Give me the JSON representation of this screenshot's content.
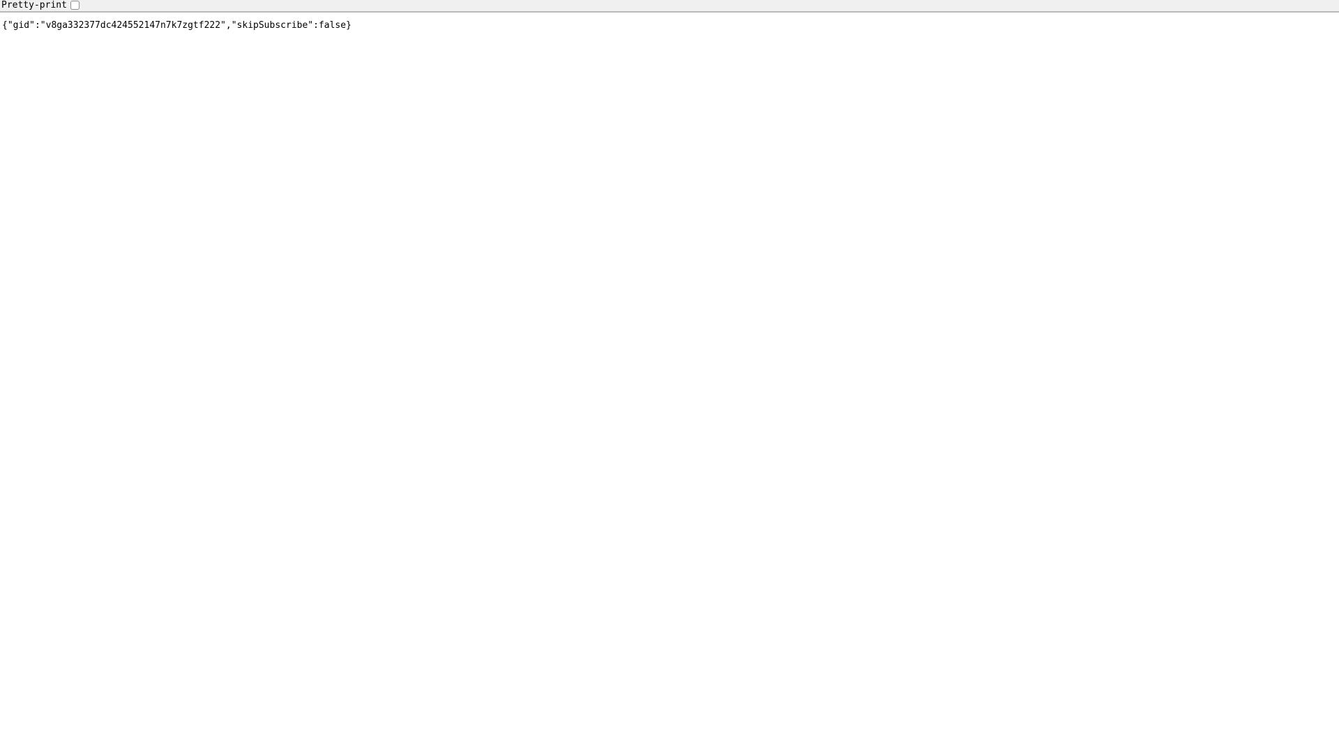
{
  "colors": {
    "header_bg": "#f0f0f0",
    "header_border": "#b9b9b9",
    "body_bg": "#ffffff",
    "text": "#000000",
    "checkbox_border": "#8f8f8f"
  },
  "header": {
    "pretty_print_label": "Pretty-print",
    "pretty_print_checked": false
  },
  "content": {
    "json_text": "{\"gid\":\"v8ga332377dc424552147n7k7zgtf222\",\"skipSubscribe\":false}"
  }
}
